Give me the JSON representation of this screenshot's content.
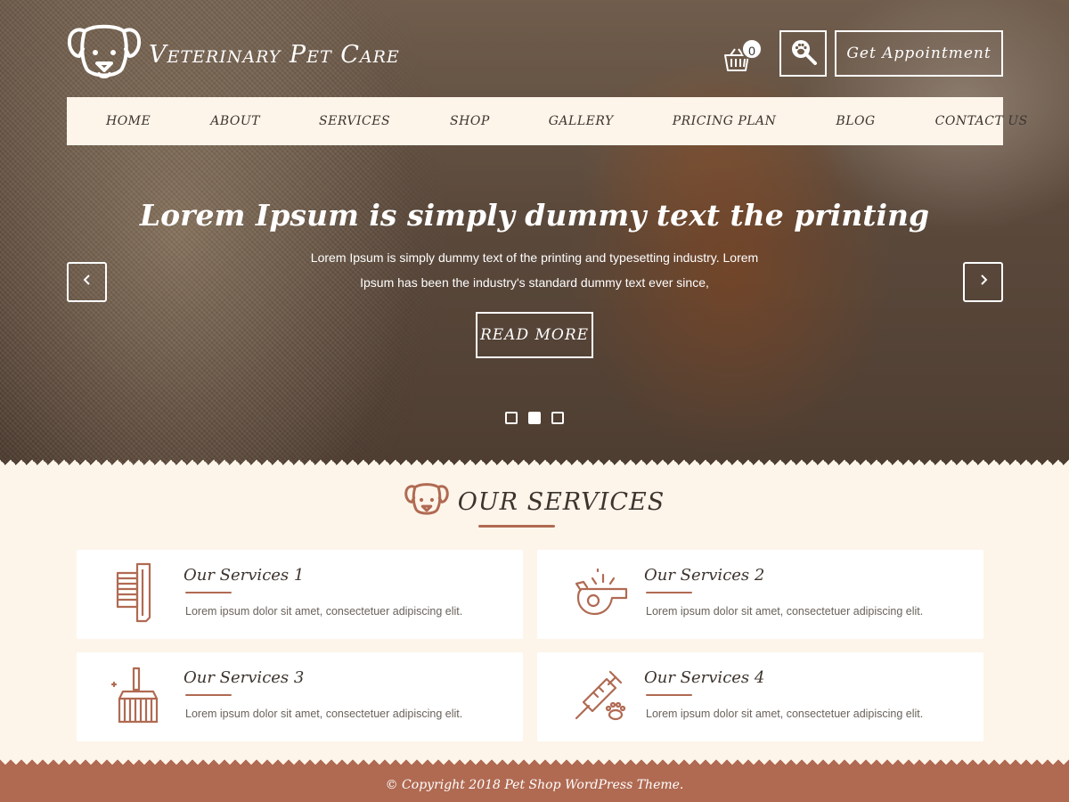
{
  "header": {
    "site_title": "Veterinary Pet Care",
    "cart_count": "0",
    "appointment_label": "Get Appointment"
  },
  "nav": {
    "items": [
      "HOME",
      "ABOUT",
      "SERVICES",
      "SHOP",
      "GALLERY",
      "PRICING PLAN",
      "BLOG",
      "CONTACT US"
    ]
  },
  "slider": {
    "title": "Lorem Ipsum is simply dummy text the printing",
    "text_line1": "Lorem Ipsum is simply dummy text of the printing and typesetting industry. Lorem",
    "text_line2": "Ipsum has been the industry's standard dummy text ever since,",
    "button_label": "READ MORE",
    "slide_count": 3,
    "active_slide": 2
  },
  "services": {
    "title": "OUR SERVICES",
    "items": [
      {
        "title": "Our Services 1",
        "text": "Lorem ipsum dolor sit amet, consectetuer adipiscing elit.",
        "icon": "brush-icon"
      },
      {
        "title": "Our Services 2",
        "text": "Lorem ipsum dolor sit amet, consectetuer adipiscing elit.",
        "icon": "whistle-icon"
      },
      {
        "title": "Our Services 3",
        "text": "Lorem ipsum dolor sit amet, consectetuer adipiscing elit.",
        "icon": "grooming-brush-icon"
      },
      {
        "title": "Our Services 4",
        "text": "Lorem ipsum dolor sit amet, consectetuer adipiscing elit.",
        "icon": "syringe-paw-icon"
      }
    ]
  },
  "footer": {
    "copyright": "© Copyright 2018 Pet Shop WordPress Theme."
  },
  "colors": {
    "accent": "#b06a52",
    "background": "#fdf5ea",
    "text_dark": "#3d342e"
  }
}
